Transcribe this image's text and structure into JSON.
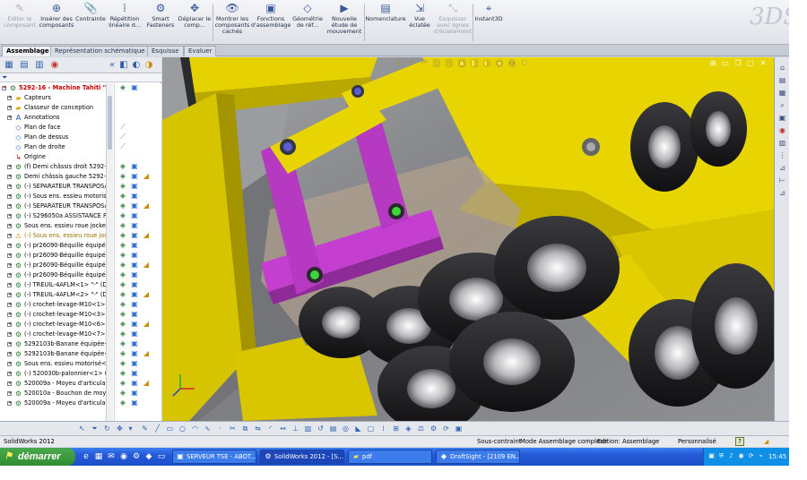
{
  "ribbon": {
    "buttons": [
      {
        "label": "Editer le composant",
        "icon": "edit-component-icon",
        "disabled": true
      },
      {
        "label": "Insérer des composants",
        "icon": "insert-components-icon"
      },
      {
        "label": "Contrainte",
        "icon": "mate-icon"
      },
      {
        "label": "Répétition linéaire d...",
        "icon": "linear-pattern-icon"
      },
      {
        "label": "Smart Fasteners",
        "icon": "smart-fasteners-icon"
      },
      {
        "label": "Déplacer le comp...",
        "icon": "move-component-icon"
      },
      {
        "label": "Montrer les composants cachés",
        "icon": "show-hidden-icon"
      },
      {
        "label": "Fonctions d'assemblage",
        "icon": "assembly-features-icon"
      },
      {
        "label": "Géométrie de réf...",
        "icon": "reference-geometry-icon"
      },
      {
        "label": "Nouvelle étude de mouvement",
        "icon": "motion-study-icon"
      },
      {
        "label": "Nomenclature",
        "icon": "bom-icon"
      },
      {
        "label": "Vue éclatée",
        "icon": "exploded-view-icon"
      },
      {
        "label": "Esquisser avec lignes d'éclatement",
        "icon": "explode-line-sketch-icon",
        "disabled": true
      },
      {
        "label": "Instant3D",
        "icon": "instant3d-icon"
      }
    ],
    "logo": "3DS"
  },
  "tabs": [
    {
      "label": "Assemblage",
      "active": true
    },
    {
      "label": "Représentation schématique"
    },
    {
      "label": "Esquisse"
    },
    {
      "label": "Evaluer"
    }
  ],
  "tree": {
    "filter_icon": "filter-icon",
    "items": [
      {
        "label": "5292-16 - Machine Tahiti \"-\" (I",
        "type": "root"
      },
      {
        "label": "Capteurs",
        "type": "folder"
      },
      {
        "label": "Classeur de conception",
        "type": "folder"
      },
      {
        "label": "Annotations",
        "type": "annot"
      },
      {
        "label": "Plan de face",
        "type": "plane"
      },
      {
        "label": "Plan de dessus",
        "type": "plane"
      },
      {
        "label": "Plan de droite",
        "type": "plane"
      },
      {
        "label": "Origine",
        "type": "origin"
      },
      {
        "label": "(f) Demi châssis droit 5292-16",
        "type": "part"
      },
      {
        "label": "Demi châssis gauche 5292-16",
        "type": "part"
      },
      {
        "label": "(-) SEPARATEUR TRANSPOSA",
        "type": "part"
      },
      {
        "label": "(-) Sous ens. essieu motorisé<",
        "type": "part"
      },
      {
        "label": "(-) SEPARATEUR TRANSPOSA",
        "type": "part"
      },
      {
        "label": "(-) S296050a ASSISTANCE FU",
        "type": "part"
      },
      {
        "label": "Sous ens. essieu roue jockey<",
        "type": "part"
      },
      {
        "label": "(-) Sous ens. essieu roue jock",
        "type": "warn"
      },
      {
        "label": "(-) pr26090-Béquille équipée<",
        "type": "part"
      },
      {
        "label": "(-) pr26090-Béquille équipée<",
        "type": "part"
      },
      {
        "label": "(-) pr26090-Béquille équipée<",
        "type": "part"
      },
      {
        "label": "(-) pr26090-Béquille équipée<",
        "type": "part"
      },
      {
        "label": "(-) TREUIL-4AFLM<1> \"-\" (Dé",
        "type": "part"
      },
      {
        "label": "(-) TREUIL-4AFLM<2> \"-\" (Dé",
        "type": "part"
      },
      {
        "label": "(-) crochet-levage-M10<1> \"-",
        "type": "part"
      },
      {
        "label": "(-) crochet-levage-M10<3> \"-",
        "type": "part"
      },
      {
        "label": "(-) crochet-levage-M10<6> \"-",
        "type": "part"
      },
      {
        "label": "(-) crochet-levage-M10<7> \"-",
        "type": "part"
      },
      {
        "label": "5292103b-Banane équipée<1",
        "type": "part"
      },
      {
        "label": "5292103b-Banane équipée<2",
        "type": "part"
      },
      {
        "label": "Sous ens. essieu motorisé<2>",
        "type": "part"
      },
      {
        "label": "(-) 520030b-palonnier<1> (Dé",
        "type": "part"
      },
      {
        "label": "520009a - Moyeu d'articulatio",
        "type": "part"
      },
      {
        "label": "520010a - Bouchon de moyeu",
        "type": "part"
      },
      {
        "label": "520009a - Moyeu d'articulatio",
        "type": "part"
      }
    ]
  },
  "status": {
    "app": "SolidWorks 2012",
    "constraint": "Sous-contraint",
    "mode": "Mode Assemblage complexe",
    "edition": "Edition: Assemblage",
    "units": "Personnalisé",
    "help": "?"
  },
  "taskbar": {
    "start": "démarrer",
    "tasks": [
      {
        "label": "SERVEUR TSE - ABOT...",
        "icon": "remote-desktop-icon"
      },
      {
        "label": "SolidWorks 2012 - [S...",
        "icon": "solidworks-icon",
        "active": true
      },
      {
        "label": "pdf",
        "icon": "folder-icon"
      },
      {
        "label": "DraftSight - [2109 EN...",
        "icon": "draftsight-icon"
      }
    ],
    "clock": "15:45"
  },
  "colors": {
    "chassis_yellow": "#e8d400",
    "arm_magenta": "#c43fcf",
    "tire_black": "#1c1c1e",
    "ground_gray": "#8d8f92"
  }
}
